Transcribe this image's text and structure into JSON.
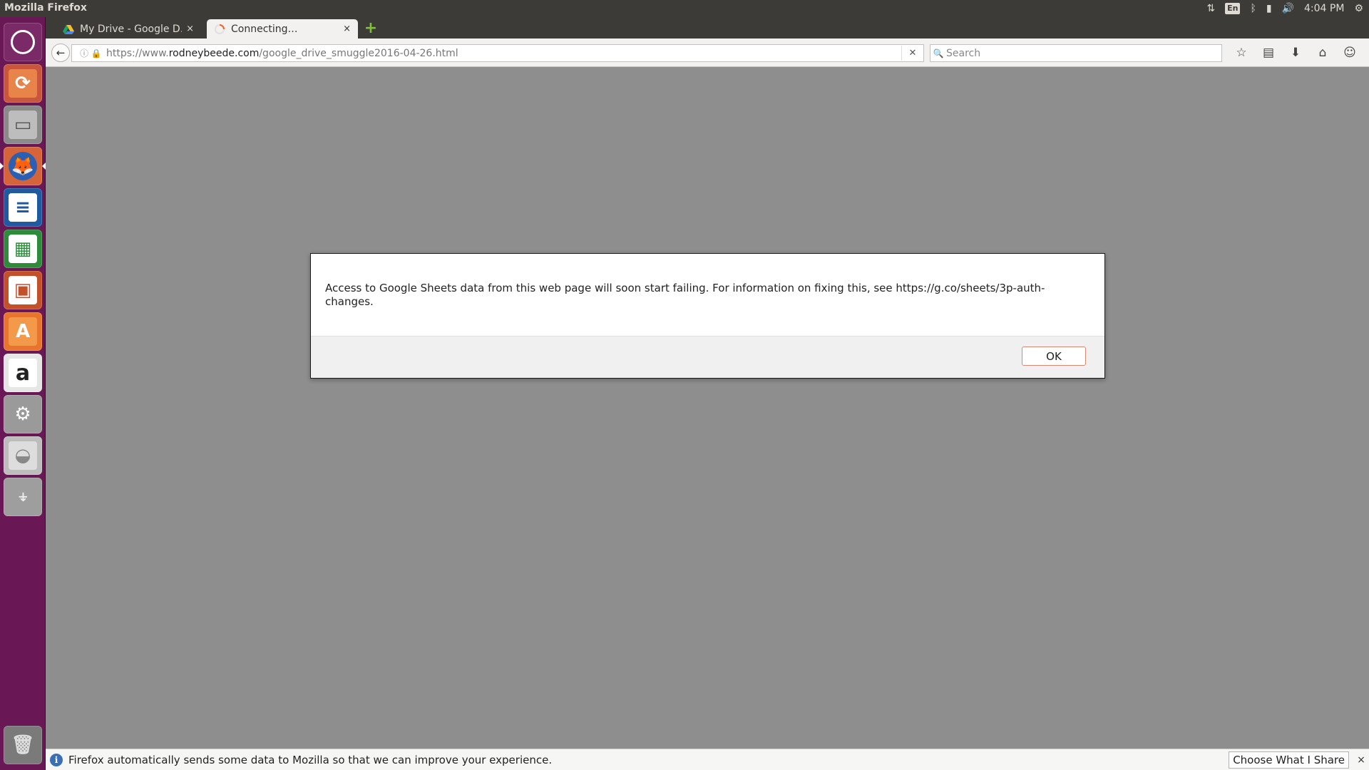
{
  "window": {
    "title": "Mozilla Firefox"
  },
  "tray": {
    "clock": "4:04 PM",
    "lang": "En"
  },
  "tabs": [
    {
      "label": "My Drive - Google D…",
      "close": "×",
      "icon": "google-drive-icon"
    },
    {
      "label": "Connecting…",
      "close": "×",
      "icon": "loading-spinner-icon"
    }
  ],
  "newtab": "+",
  "navbar": {
    "url_prefix": "https://www.",
    "url_domain": "rodneybeede.com",
    "url_path": "/google_drive_smuggle2016-04-26.html",
    "search_placeholder": "Search"
  },
  "dialog": {
    "message": "Access to Google Sheets data from this web page will soon start failing.  For information on fixing this, see https://g.co/sheets/3p-auth-changes.",
    "ok_label": "OK"
  },
  "notification": {
    "text": "Firefox automatically sends some data to Mozilla so that we can improve your experience.",
    "button_label": "Choose What I Share",
    "close": "×"
  },
  "colors": {
    "launcher": "#6a1855",
    "panel": "#3c3b37",
    "content": "#8e8e8e"
  }
}
